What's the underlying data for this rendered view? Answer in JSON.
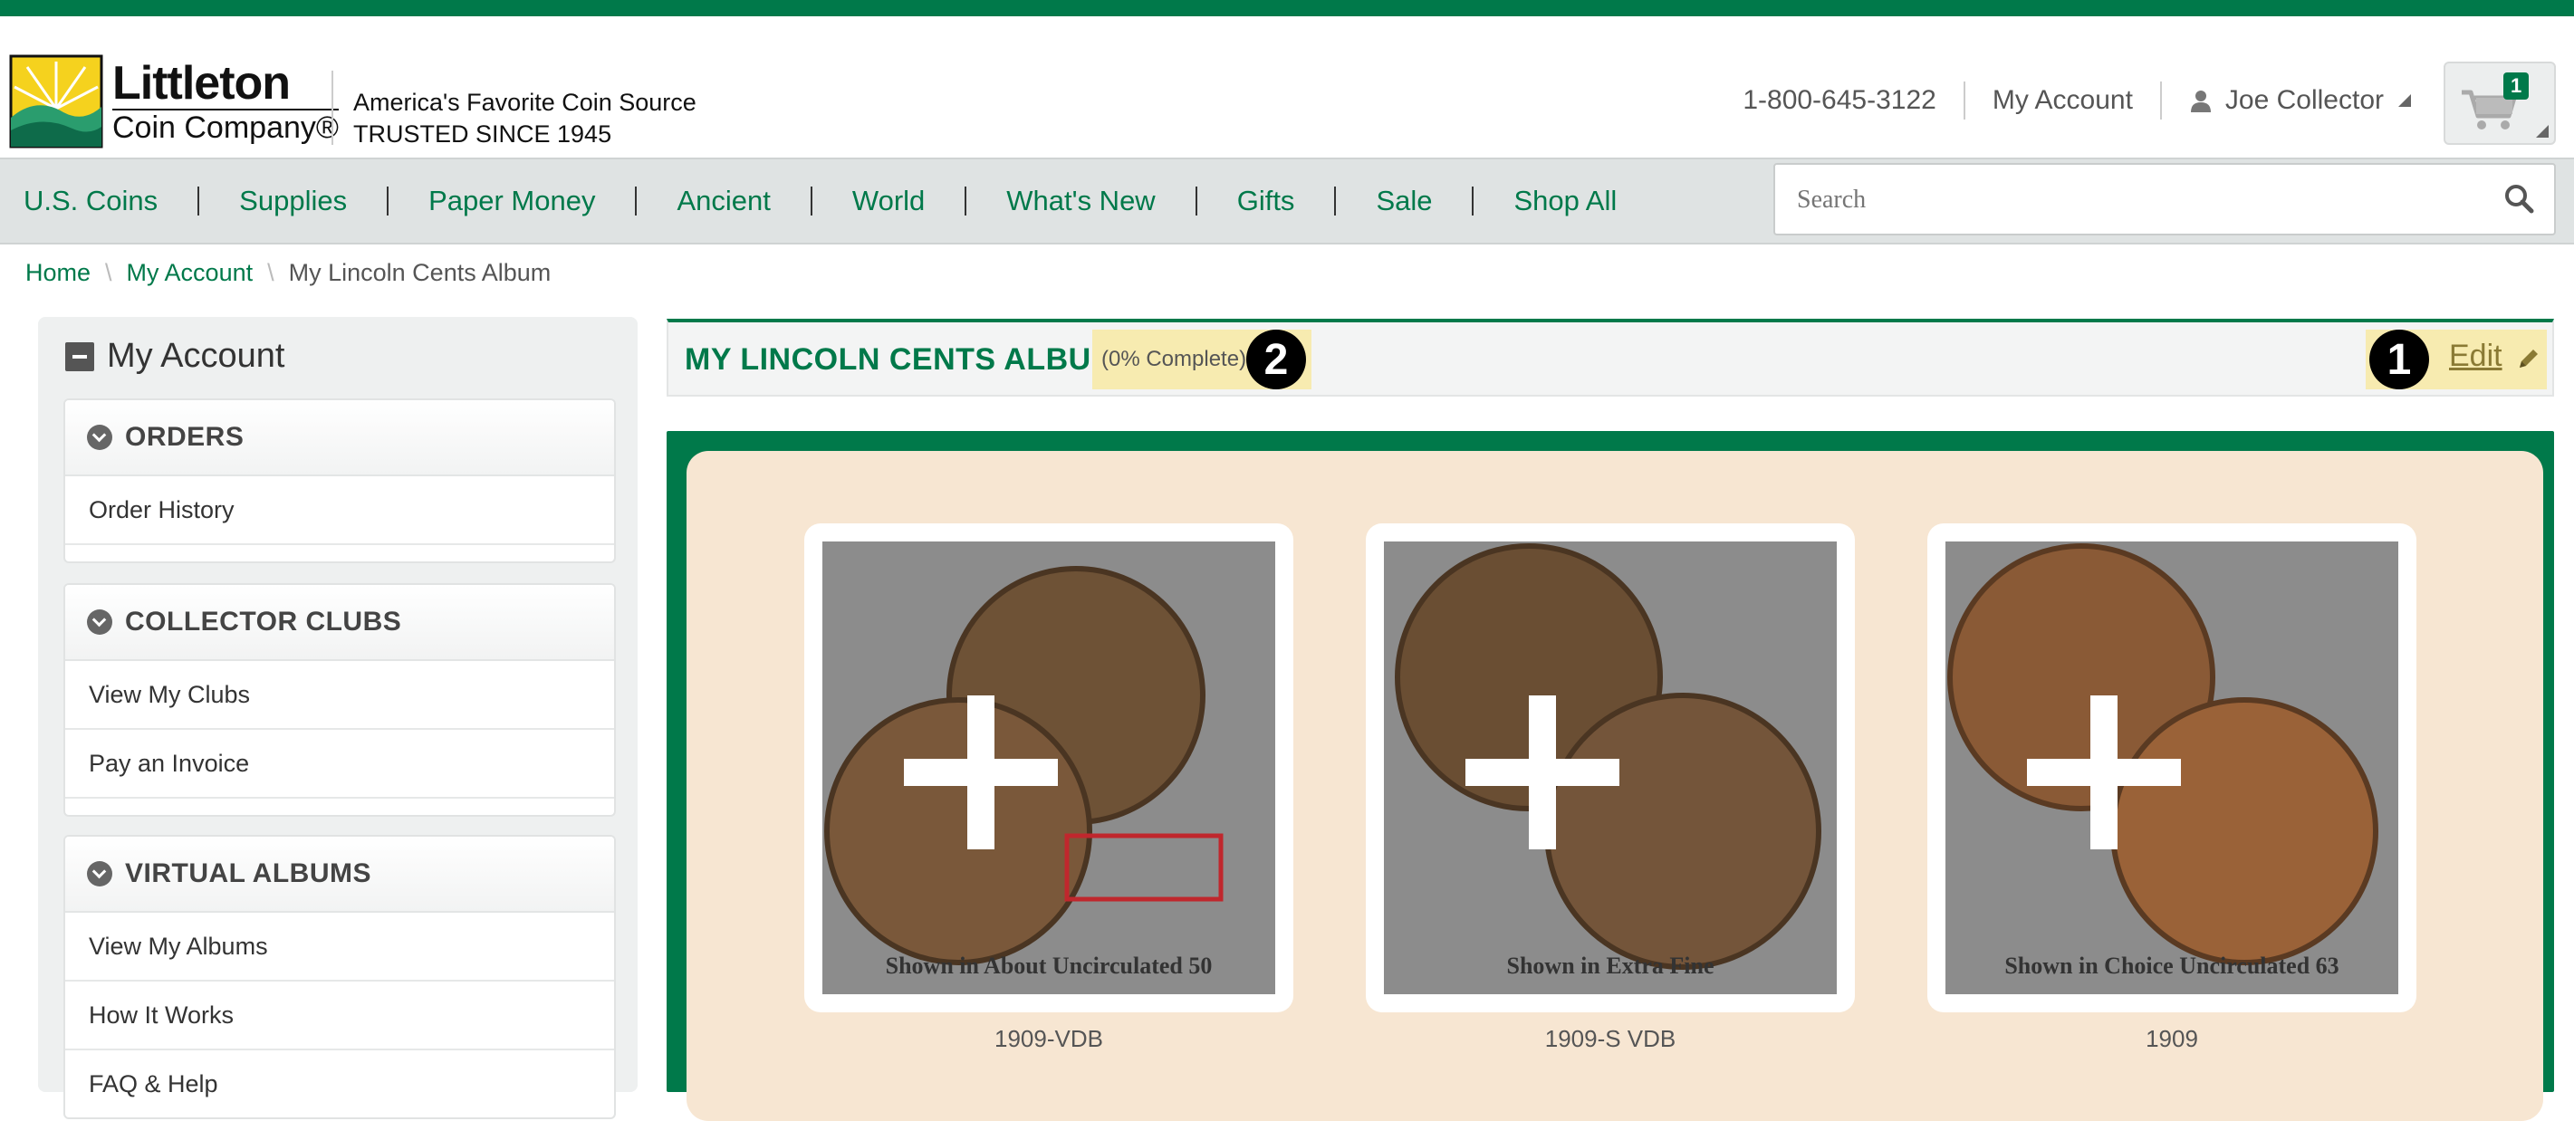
{
  "header": {
    "logo_line1": "Littleton",
    "logo_line2": "Coin Company®",
    "tagline_1": "America's Favorite Coin Source",
    "tagline_2": "TRUSTED SINCE 1945",
    "phone": "1-800-645-3122",
    "my_account": "My Account",
    "user_name": "Joe Collector",
    "cart_count": "1"
  },
  "nav": {
    "items": [
      "U.S. Coins",
      "Supplies",
      "Paper Money",
      "Ancient",
      "World",
      "What's New",
      "Gifts",
      "Sale",
      "Shop All"
    ],
    "search_placeholder": "Search"
  },
  "breadcrumb": {
    "home": "Home",
    "account": "My Account",
    "current": "My Lincoln Cents Album"
  },
  "sidebar": {
    "title": "My Account",
    "sections": [
      {
        "heading": "ORDERS",
        "items": [
          "Order History"
        ]
      },
      {
        "heading": "COLLECTOR CLUBS",
        "items": [
          "View My Clubs",
          "Pay an Invoice"
        ]
      },
      {
        "heading": "VIRTUAL ALBUMS",
        "items": [
          "View My Albums",
          "How It Works",
          "FAQ & Help"
        ]
      }
    ]
  },
  "album": {
    "title": "MY LINCOLN CENTS ALBUM",
    "complete": "(0% Complete)",
    "badge_2": "2",
    "badge_1": "1",
    "edit": "Edit",
    "slots": [
      {
        "label": "1909-VDB",
        "caption": "Shown in About Uncirculated 50"
      },
      {
        "label": "1909-S VDB",
        "caption": "Shown in Extra Fine"
      },
      {
        "label": "1909",
        "caption": "Shown in Choice Uncirculated 63"
      }
    ]
  },
  "colors": {
    "brand_green": "#00794a",
    "highlight": "#f7ebb0",
    "album_bg": "#f7e6d2"
  }
}
